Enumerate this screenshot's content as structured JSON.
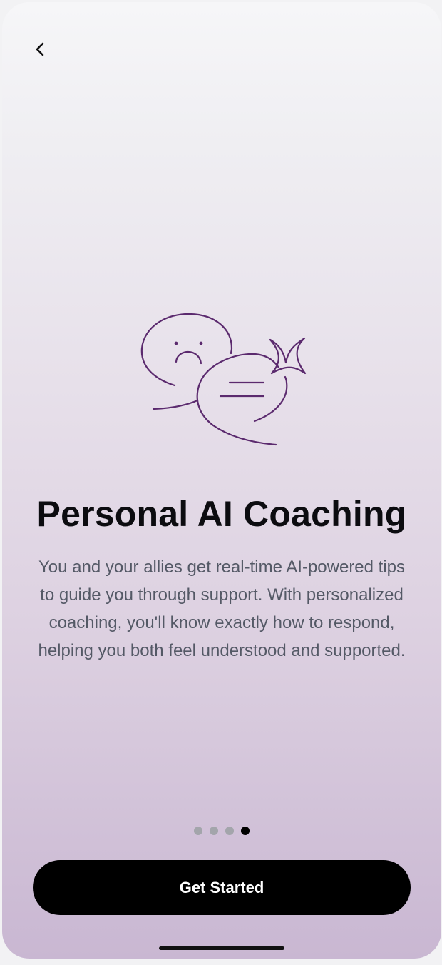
{
  "header": {
    "back_icon": "chevron-left-icon"
  },
  "illustration": {
    "icon": "chat-bubbles-sparkle-icon",
    "stroke_color": "#5b2a6e"
  },
  "content": {
    "title": "Personal AI Coaching",
    "description": "You and your allies get real-time AI-powered tips to guide you through support. With personalized coaching, you'll know exactly how to respond, helping you both feel understood and supported."
  },
  "pager": {
    "total": 4,
    "active_index": 3
  },
  "cta": {
    "label": "Get Started"
  },
  "colors": {
    "gradient_top": "#f6f6f8",
    "gradient_bottom": "#c9b7d2",
    "button_bg": "#000000",
    "button_text": "#ffffff",
    "dot_inactive": "#a3a5ab",
    "dot_active": "#000000"
  }
}
